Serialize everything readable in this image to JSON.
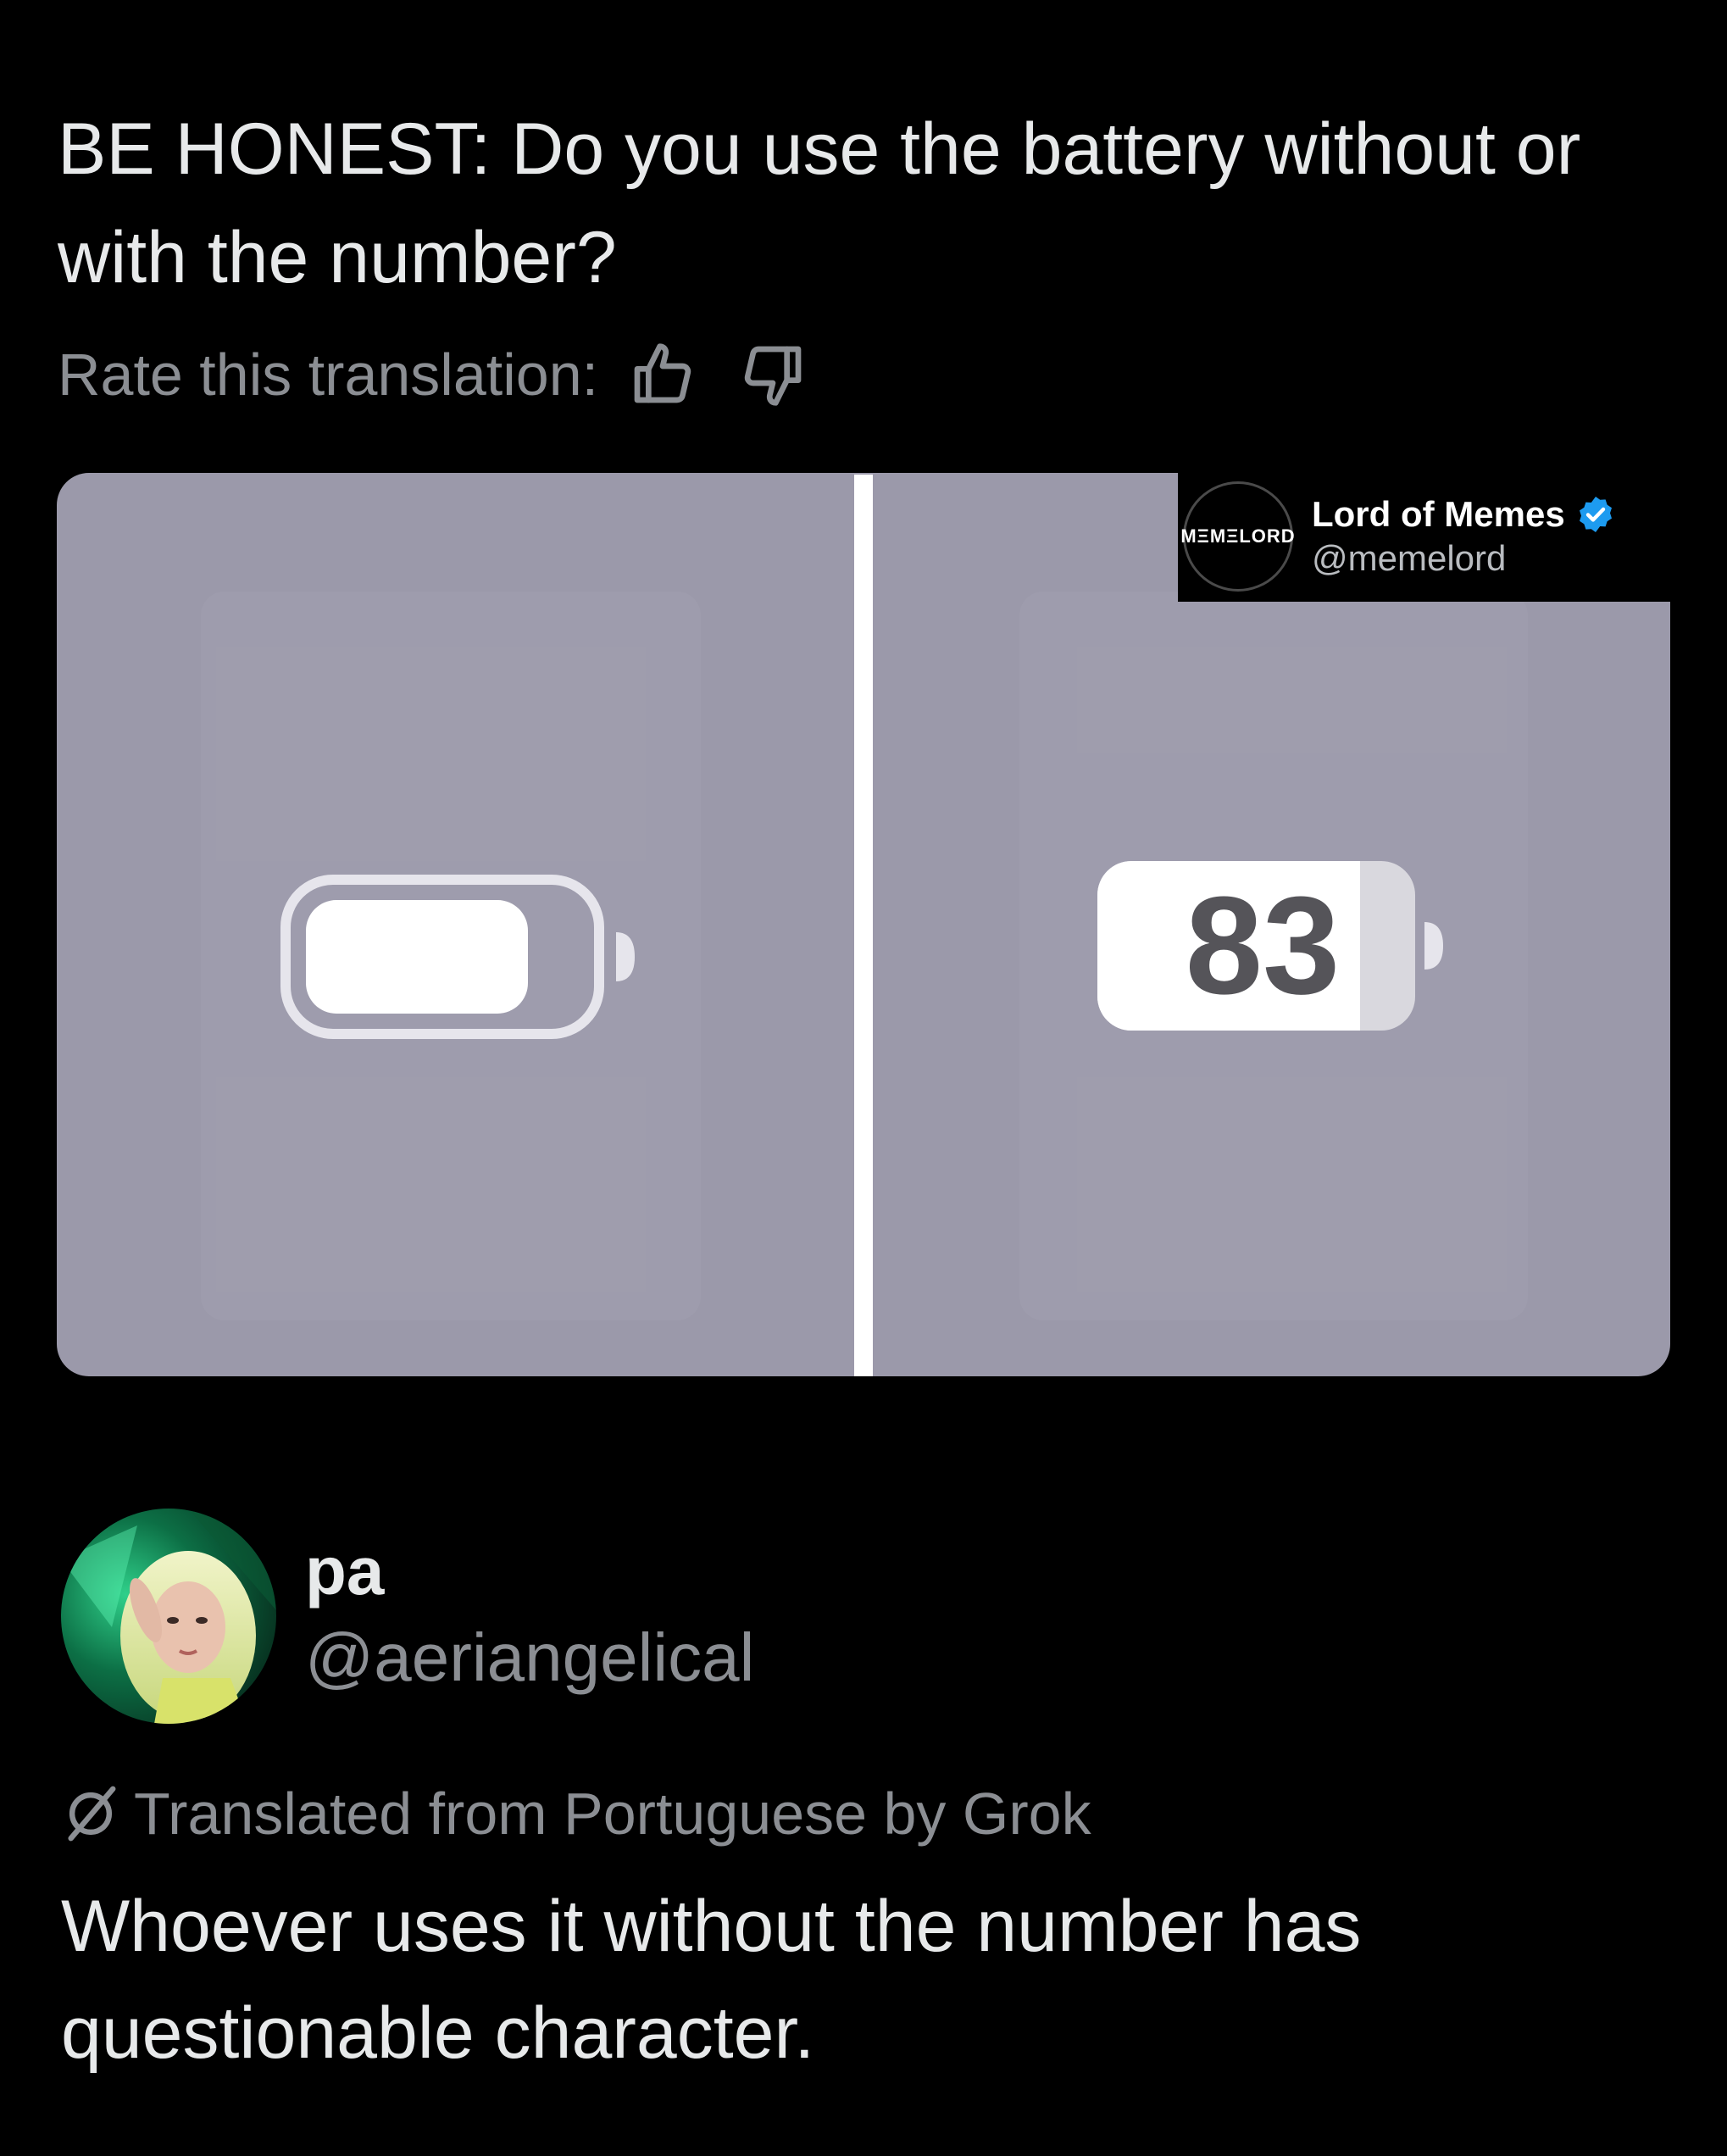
{
  "post": {
    "text": "BE HONEST: Do you use the battery without or with the number?",
    "rate_label": "Rate this translation:",
    "thumbs_up_icon": "thumbs-up-icon",
    "thumbs_down_icon": "thumbs-down-icon"
  },
  "media": {
    "right_battery_number": "83",
    "background_color": "#9b99aa"
  },
  "watermark": {
    "logo_text": "MΞMΞLORD",
    "name": "Lord of Memes",
    "handle": "@memelord",
    "verified_icon": "verified-badge-icon",
    "verified_color": "#1d9bf0"
  },
  "reply": {
    "name": "pa",
    "handle": "@aeriangelical",
    "translated_label": "Translated from Portuguese by Grok",
    "text": "Whoever uses it without the number has questionable character."
  }
}
